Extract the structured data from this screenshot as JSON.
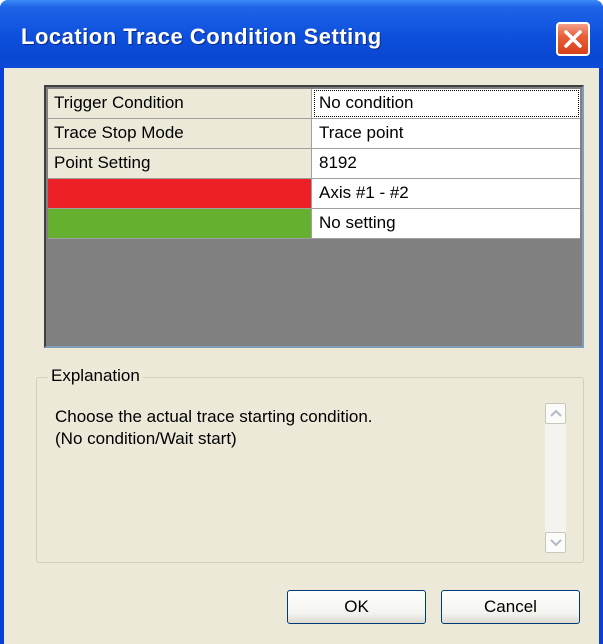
{
  "window": {
    "title": "Location Trace Condition Setting",
    "close_icon": "close-icon"
  },
  "grid": {
    "rows": [
      {
        "key": "Trigger Condition",
        "value": "No condition",
        "key_color": "#ece9d8"
      },
      {
        "key": "Trace Stop Mode",
        "value": "Trace point",
        "key_color": "#ece9d8"
      },
      {
        "key": "Point Setting",
        "value": "8192",
        "key_color": "#ece9d8"
      },
      {
        "key": "",
        "value": "Axis #1 - #2",
        "key_color": "#ee2027"
      },
      {
        "key": "",
        "value": "No setting",
        "key_color": "#66b030"
      }
    ]
  },
  "explanation": {
    "legend": "Explanation",
    "line1": "Choose the actual trace starting condition.",
    "line2": "(No condition/Wait start)"
  },
  "buttons": {
    "ok": "OK",
    "cancel": "Cancel"
  }
}
